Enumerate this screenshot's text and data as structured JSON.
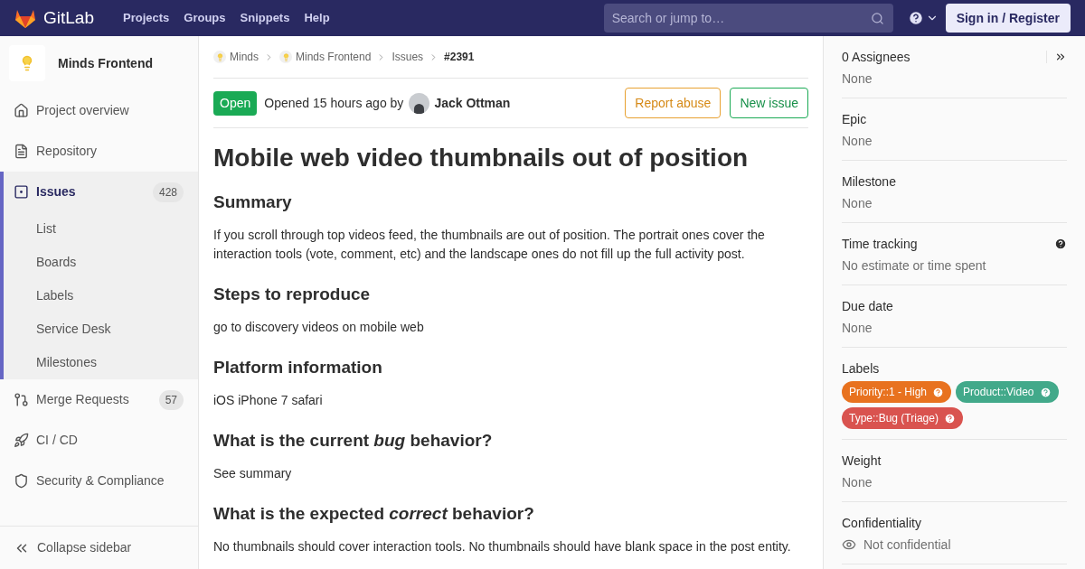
{
  "header": {
    "brand": "GitLab",
    "nav": [
      "Projects",
      "Groups",
      "Snippets",
      "Help"
    ],
    "search": {
      "placeholder": "Search or jump to…"
    },
    "sign_in": "Sign in / Register"
  },
  "sidebar": {
    "project": "Minds Frontend",
    "items": [
      {
        "label": "Project overview",
        "selected": false
      },
      {
        "label": "Repository",
        "selected": false
      },
      {
        "label": "Issues",
        "selected": true,
        "count": "428",
        "children": [
          {
            "label": "List"
          },
          {
            "label": "Boards"
          },
          {
            "label": "Labels"
          },
          {
            "label": "Service Desk"
          },
          {
            "label": "Milestones"
          }
        ]
      },
      {
        "label": "Merge Requests",
        "selected": false,
        "count": "57"
      },
      {
        "label": "CI / CD",
        "selected": false
      },
      {
        "label": "Security & Compliance",
        "selected": false
      }
    ],
    "collapse": "Collapse sidebar"
  },
  "breadcrumbs": [
    {
      "label": "Minds",
      "kind": "group"
    },
    {
      "label": "Minds Frontend",
      "kind": "group"
    },
    {
      "label": "Issues",
      "kind": "link"
    },
    {
      "label": "#2391",
      "kind": "current"
    }
  ],
  "issue": {
    "status": "Open",
    "opened": "Opened 15 hours ago by",
    "author": "Jack Ottman",
    "actions": [
      {
        "label": "Report abuse",
        "kind": "warning"
      },
      {
        "label": "New issue",
        "kind": "success"
      }
    ],
    "title": "Mobile web video thumbnails out of position",
    "sections": [
      {
        "heading": "Summary",
        "text": "If you scroll through top videos feed, the thumbnails are out of position. The portrait ones cover the interaction tools (vote, comment, etc) and the landscape ones do not fill up the full activity post."
      },
      {
        "heading": "Steps to reproduce",
        "text": "go to discovery videos on mobile web"
      },
      {
        "heading": "Platform information",
        "text": "iOS iPhone 7 safari"
      },
      {
        "heading": "What is the current *bug* behavior?",
        "text": "See summary"
      },
      {
        "heading": "What is the expected *correct* behavior?",
        "text": "No thumbnails should cover interaction tools. No thumbnails should have blank space in the post entity."
      }
    ]
  },
  "right_sidebar": {
    "blocks": [
      {
        "title": "0 Assignees",
        "value": "None",
        "kind": "assignees"
      },
      {
        "title": "Epic",
        "value": "None",
        "kind": "plain"
      },
      {
        "title": "Milestone",
        "value": "None",
        "kind": "plain"
      },
      {
        "title": "Time tracking",
        "value": "No estimate or time spent",
        "kind": "help"
      },
      {
        "title": "Due date",
        "value": "None",
        "kind": "plain"
      },
      {
        "title": "Labels",
        "kind": "labels",
        "labels": [
          {
            "label": "Priority::1 - High",
            "color": "#e8721f"
          },
          {
            "label": "Product::Video",
            "color": "#42a98a"
          },
          {
            "label": "Type::Bug (Triage)",
            "color": "#d9534f"
          }
        ]
      },
      {
        "title": "Weight",
        "value": "None",
        "kind": "plain"
      },
      {
        "title": "Confidentiality",
        "value": "Not confidential",
        "kind": "confidential"
      }
    ]
  }
}
